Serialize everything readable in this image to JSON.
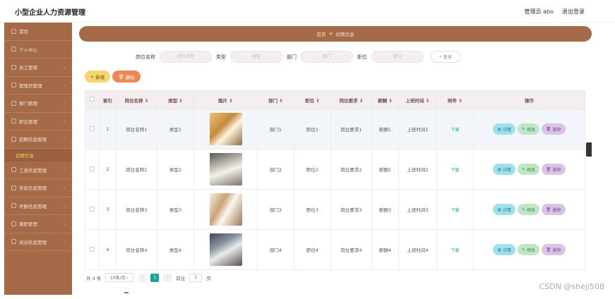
{
  "header": {
    "title": "小型企业人力资源管理",
    "user_label": "管理员 abo",
    "logout_label": "退出登录"
  },
  "sidebar": {
    "items": [
      {
        "label": "首页"
      },
      {
        "label": "个人中心"
      },
      {
        "label": "员工管理"
      },
      {
        "label": "管理员管理"
      },
      {
        "label": "部门管理"
      },
      {
        "label": "职位管理"
      },
      {
        "label": "招聘信息管理"
      },
      {
        "label": "工资信息管理"
      },
      {
        "label": "奖惩信息管理"
      },
      {
        "label": "考勤信息管理"
      },
      {
        "label": "离职管理"
      },
      {
        "label": "培训信息管理"
      }
    ],
    "active_sub": "招聘信息"
  },
  "breadcrumb": {
    "home": "首页",
    "current": "招聘信息"
  },
  "search": {
    "name_label": "岗位名称",
    "name_placeholder": "岗位名称",
    "type_label": "类型",
    "type_placeholder": "类型",
    "dept_label": "部门",
    "dept_placeholder": "部门",
    "pos_label": "职位",
    "pos_placeholder": "职位",
    "query_label": "查询"
  },
  "actions": {
    "add_label": "新增",
    "delete_label": "删除"
  },
  "table": {
    "headers": [
      "索引",
      "岗位名称 ⇕",
      "类型 ⇕",
      "图片 ⇕",
      "部门 ⇕",
      "职位 ⇕",
      "岗位要求 ⇕",
      "薪酬 ⇕",
      "上班时间 ⇕",
      "附件 ⇕",
      "操作"
    ],
    "rows": [
      {
        "index": "1",
        "name": "岗位名称1",
        "type": "类型1",
        "dept": "部门1",
        "pos": "职位1",
        "req": "岗位要求1",
        "salary": "薪酬1",
        "time": "上班时间1",
        "file": "下载"
      },
      {
        "index": "2",
        "name": "岗位名称2",
        "type": "类型2",
        "dept": "部门2",
        "pos": "职位2",
        "req": "岗位要求2",
        "salary": "薪酬2",
        "time": "上班时间2",
        "file": "下载"
      },
      {
        "index": "3",
        "name": "岗位名称3",
        "type": "类型3",
        "dept": "部门3",
        "pos": "职位3",
        "req": "岗位要求3",
        "salary": "薪酬3",
        "time": "上班时间3",
        "file": "下载"
      },
      {
        "index": "4",
        "name": "岗位名称4",
        "type": "类型4",
        "dept": "部门4",
        "pos": "职位4",
        "req": "岗位要求4",
        "salary": "薪酬4",
        "time": "上班时间4",
        "file": "下载"
      }
    ],
    "op_detail": "详情",
    "op_edit": "修改",
    "op_delete": "删除"
  },
  "pagination": {
    "total": "共 4 条",
    "page_size": "10条/页",
    "current_page": "1",
    "goto_label": "前往",
    "goto_value": "1",
    "page_unit": "页"
  },
  "watermark": "CSDN @sheji508",
  "colors": {
    "sidebar": "#a56a48",
    "accent_teal": "#1aa39a",
    "add_button": "#f5d66e",
    "delete_button": "#f08650"
  }
}
